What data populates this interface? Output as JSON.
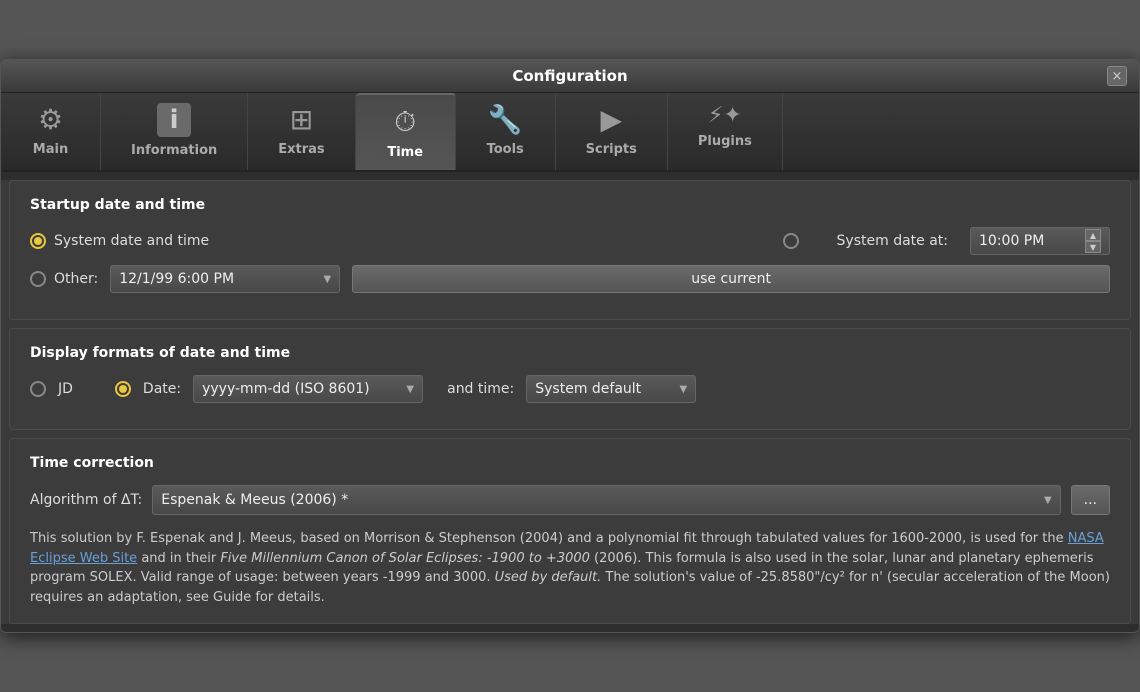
{
  "window": {
    "title": "Configuration",
    "close_label": "×"
  },
  "tabs": [
    {
      "id": "main",
      "label": "Main",
      "icon": "⚙",
      "active": false
    },
    {
      "id": "information",
      "label": "Information",
      "icon": "ℹ",
      "active": false
    },
    {
      "id": "extras",
      "label": "Extras",
      "icon": "⊞",
      "active": false
    },
    {
      "id": "time",
      "label": "Time",
      "icon": "⏱",
      "active": true
    },
    {
      "id": "tools",
      "label": "Tools",
      "icon": "🔧",
      "active": false
    },
    {
      "id": "scripts",
      "label": "Scripts",
      "icon": "▶",
      "active": false
    },
    {
      "id": "plugins",
      "label": "Plugins",
      "icon": "🔌",
      "active": false
    }
  ],
  "sections": {
    "startup": {
      "title": "Startup date and time",
      "system_date_time_label": "System date and time",
      "system_date_at_label": "System date at:",
      "system_date_time_checked": true,
      "system_date_at_checked": false,
      "time_value": "10:00 PM",
      "other_label": "Other:",
      "other_date_value": "12/1/99 6:00 PM",
      "use_current_label": "use current"
    },
    "display": {
      "title": "Display formats of date and time",
      "jd_label": "JD",
      "jd_checked": false,
      "date_label": "Date:",
      "date_format_value": "yyyy-mm-dd (ISO 8601)",
      "and_time_label": "and time:",
      "time_format_value": "System default"
    },
    "correction": {
      "title": "Time correction",
      "algorithm_label": "Algorithm of ΔT:",
      "algorithm_value": "Espenak & Meeus (2006) *",
      "dots_label": "...",
      "description": "This solution by F. Espenak and J. Meeus, based on Morrison & Stephenson (2004) and a polynomial fit through tabulated values for 1600-2000, is used for the ",
      "link_text": "NASA Eclipse Web Site",
      "description2": " and in their ",
      "italic_text": "Five Millennium Canon of Solar Eclipses: -1900 to +3000",
      "description3": " (2006). This formula is also used in the solar, lunar and planetary ephemeris program SOLEX. Valid range of usage: between years -1999 and 3000. ",
      "italic_text2": "Used by default.",
      "description4": " The solution's value of -25.8580\"/cy² for n' (secular acceleration of the Moon) requires an adaptation, see Guide for details."
    }
  }
}
